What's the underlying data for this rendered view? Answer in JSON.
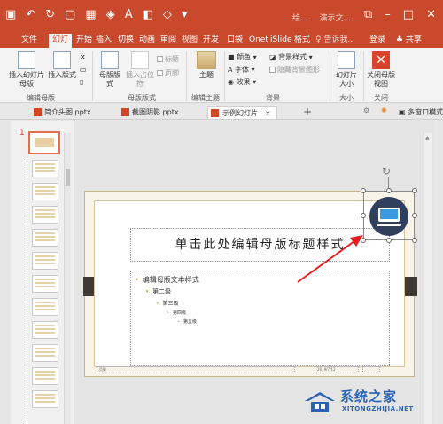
{
  "titlebar": {
    "qat_icons": [
      "save-icon",
      "undo-icon",
      "redo-icon",
      "new-doc-icon",
      "table-icon",
      "fill-icon",
      "font-color-icon",
      "shape-icon",
      "arrange-icon",
      "more-icon"
    ],
    "doc_title_1": "绘...",
    "doc_title_2": "演示文...",
    "window_controls": [
      "restore-icon",
      "minimize-icon",
      "maximize-icon",
      "close-icon"
    ]
  },
  "tabs": {
    "items": [
      "文件",
      "幻灯",
      "开始",
      "插入",
      "切换",
      "动画",
      "审阅",
      "视图",
      "开发",
      "口袋",
      "Onet",
      "iSlide",
      "格式"
    ],
    "search": "♀ 告诉我...",
    "login": "登录",
    "share": "♣ 共享"
  },
  "ribbon": {
    "insert_slide_master": "插入幻灯片母版",
    "insert_layout": "插入版式",
    "group_edit_master": "编辑母版",
    "master_layout": "母版版式",
    "insert_placeholder": "插入占位符",
    "cb_title": "标题",
    "cb_footer": "页脚",
    "group_master_layout": "母版版式",
    "theme": "主题",
    "group_edit_theme": "编辑主题",
    "colors": "颜色",
    "fonts": "字体",
    "effects": "效果",
    "bg_styles": "背景样式",
    "hide_bg": "隐藏背景图形",
    "group_background": "背景",
    "slide_size": "幻灯片大小",
    "group_size": "大小",
    "close_master": "关闭母版视图",
    "group_close": "关闭"
  },
  "doctabs": {
    "items": [
      "简介头图.pptx",
      "截图阴影.pptx"
    ],
    "active": "示例幻灯片",
    "close": "×",
    "plus": "+",
    "multiwin": "多窗口模式"
  },
  "thumbs": {
    "number": "1"
  },
  "slide": {
    "title": "单击此处编辑母版标题样式",
    "levels": [
      "编辑母版文本样式",
      "第二级",
      "第三级",
      "第四级",
      "第五级"
    ],
    "footer_left": "页脚",
    "footer_date": "2019/7/12"
  },
  "watermark": {
    "name": "系统之家",
    "url": "XITONGZHIJIA.NET"
  },
  "colors": {
    "accent": "#c8492c",
    "arrow": "#e02020",
    "icon_circle": "#2f3f5c"
  }
}
